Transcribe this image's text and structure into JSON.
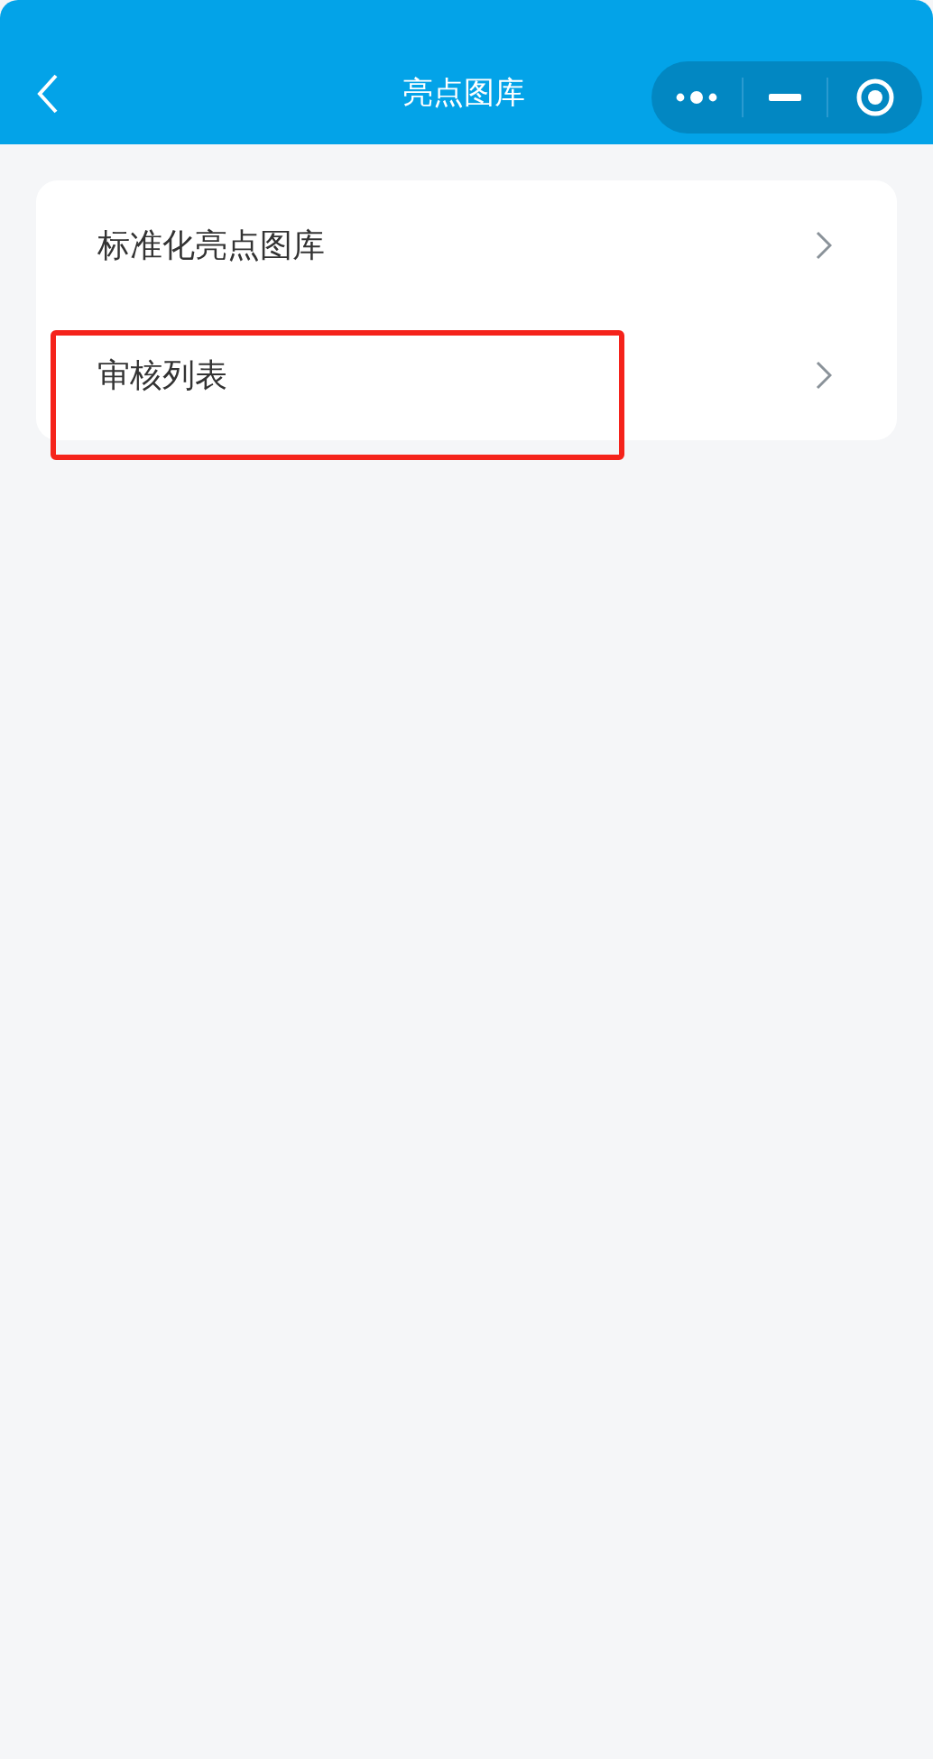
{
  "header": {
    "title": "亮点图库"
  },
  "menu": [
    {
      "label": "标准化亮点图库",
      "highlighted": false
    },
    {
      "label": "审核列表",
      "highlighted": true
    }
  ]
}
